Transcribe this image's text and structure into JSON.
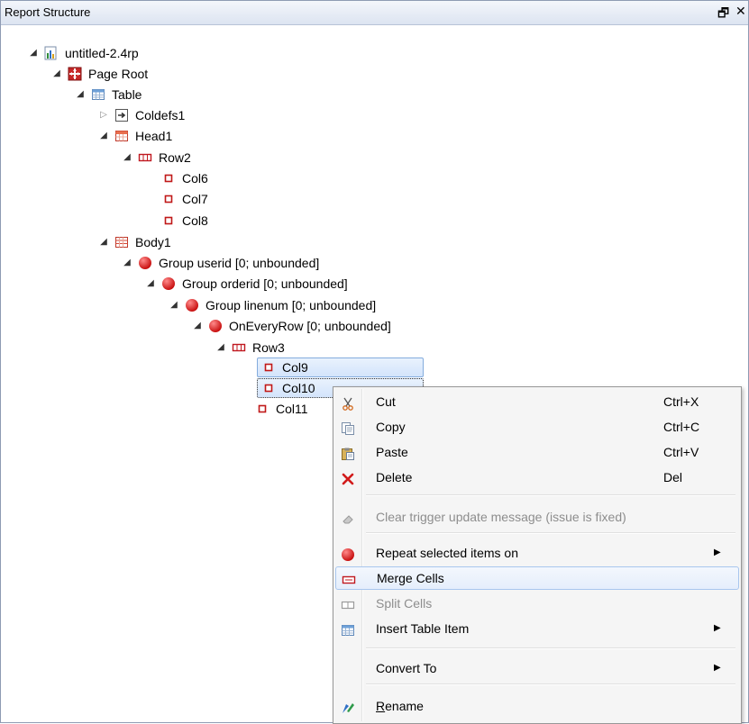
{
  "panel": {
    "title": "Report Structure",
    "restore_glyph": "🗗",
    "close_glyph": "✕"
  },
  "tree": [
    {
      "label": "untitled-2.4rp",
      "icon": "report-file-icon",
      "expanded": true
    },
    {
      "label": "Page Root",
      "icon": "page-root-icon",
      "expanded": true
    },
    {
      "label": "Table",
      "icon": "table-icon",
      "expanded": true
    },
    {
      "label": "Coldefs1",
      "icon": "coldefs-icon",
      "expanded": false
    },
    {
      "label": "Head1",
      "icon": "table-head-icon",
      "expanded": true
    },
    {
      "label": "Row2",
      "icon": "row-icon",
      "expanded": true
    },
    {
      "label": "Col6",
      "icon": "col-icon"
    },
    {
      "label": "Col7",
      "icon": "col-icon"
    },
    {
      "label": "Col8",
      "icon": "col-icon"
    },
    {
      "label": "Body1",
      "icon": "table-body-icon",
      "expanded": true
    },
    {
      "label": "Group userid [0; unbounded]",
      "icon": "group-icon",
      "expanded": true
    },
    {
      "label": "Group orderid [0; unbounded]",
      "icon": "group-icon",
      "expanded": true
    },
    {
      "label": "Group linenum [0; unbounded]",
      "icon": "group-icon",
      "expanded": true
    },
    {
      "label": "OnEveryRow [0; unbounded]",
      "icon": "group-icon",
      "expanded": true
    },
    {
      "label": "Row3",
      "icon": "row-icon",
      "expanded": true
    },
    {
      "label": "Col9",
      "icon": "col-icon",
      "state": "selected"
    },
    {
      "label": "Col10",
      "icon": "col-icon",
      "state": "focused"
    },
    {
      "label": "Col11",
      "icon": "col-icon"
    }
  ],
  "context_menu": [
    {
      "label": "Cut",
      "shortcut": "Ctrl+X",
      "icon": "scissors-icon"
    },
    {
      "label": "Copy",
      "shortcut": "Ctrl+C",
      "icon": "copy-icon"
    },
    {
      "label": "Paste",
      "shortcut": "Ctrl+V",
      "icon": "paste-icon"
    },
    {
      "label": "Delete",
      "shortcut": "Del",
      "icon": "delete-icon"
    },
    {
      "label": "Clear trigger update message (issue is fixed)",
      "icon": "eraser-icon",
      "disabled": true
    },
    {
      "label": "Repeat selected items on",
      "icon": "group-icon",
      "submenu": true
    },
    {
      "label": "Merge Cells",
      "icon": "merge-cells-icon",
      "hover": true
    },
    {
      "label": "Split Cells",
      "icon": "split-cells-icon",
      "disabled": true
    },
    {
      "label": "Insert Table Item",
      "icon": "table-icon",
      "submenu": true
    },
    {
      "label": "Convert To",
      "submenu": true
    },
    {
      "label": "Rename",
      "icon": "rename-icon"
    }
  ],
  "submenu_arrow": "▶",
  "colors": {
    "selection_border": "#84acdd",
    "group_red": "#d21f1f",
    "col_red": "#c01818"
  }
}
